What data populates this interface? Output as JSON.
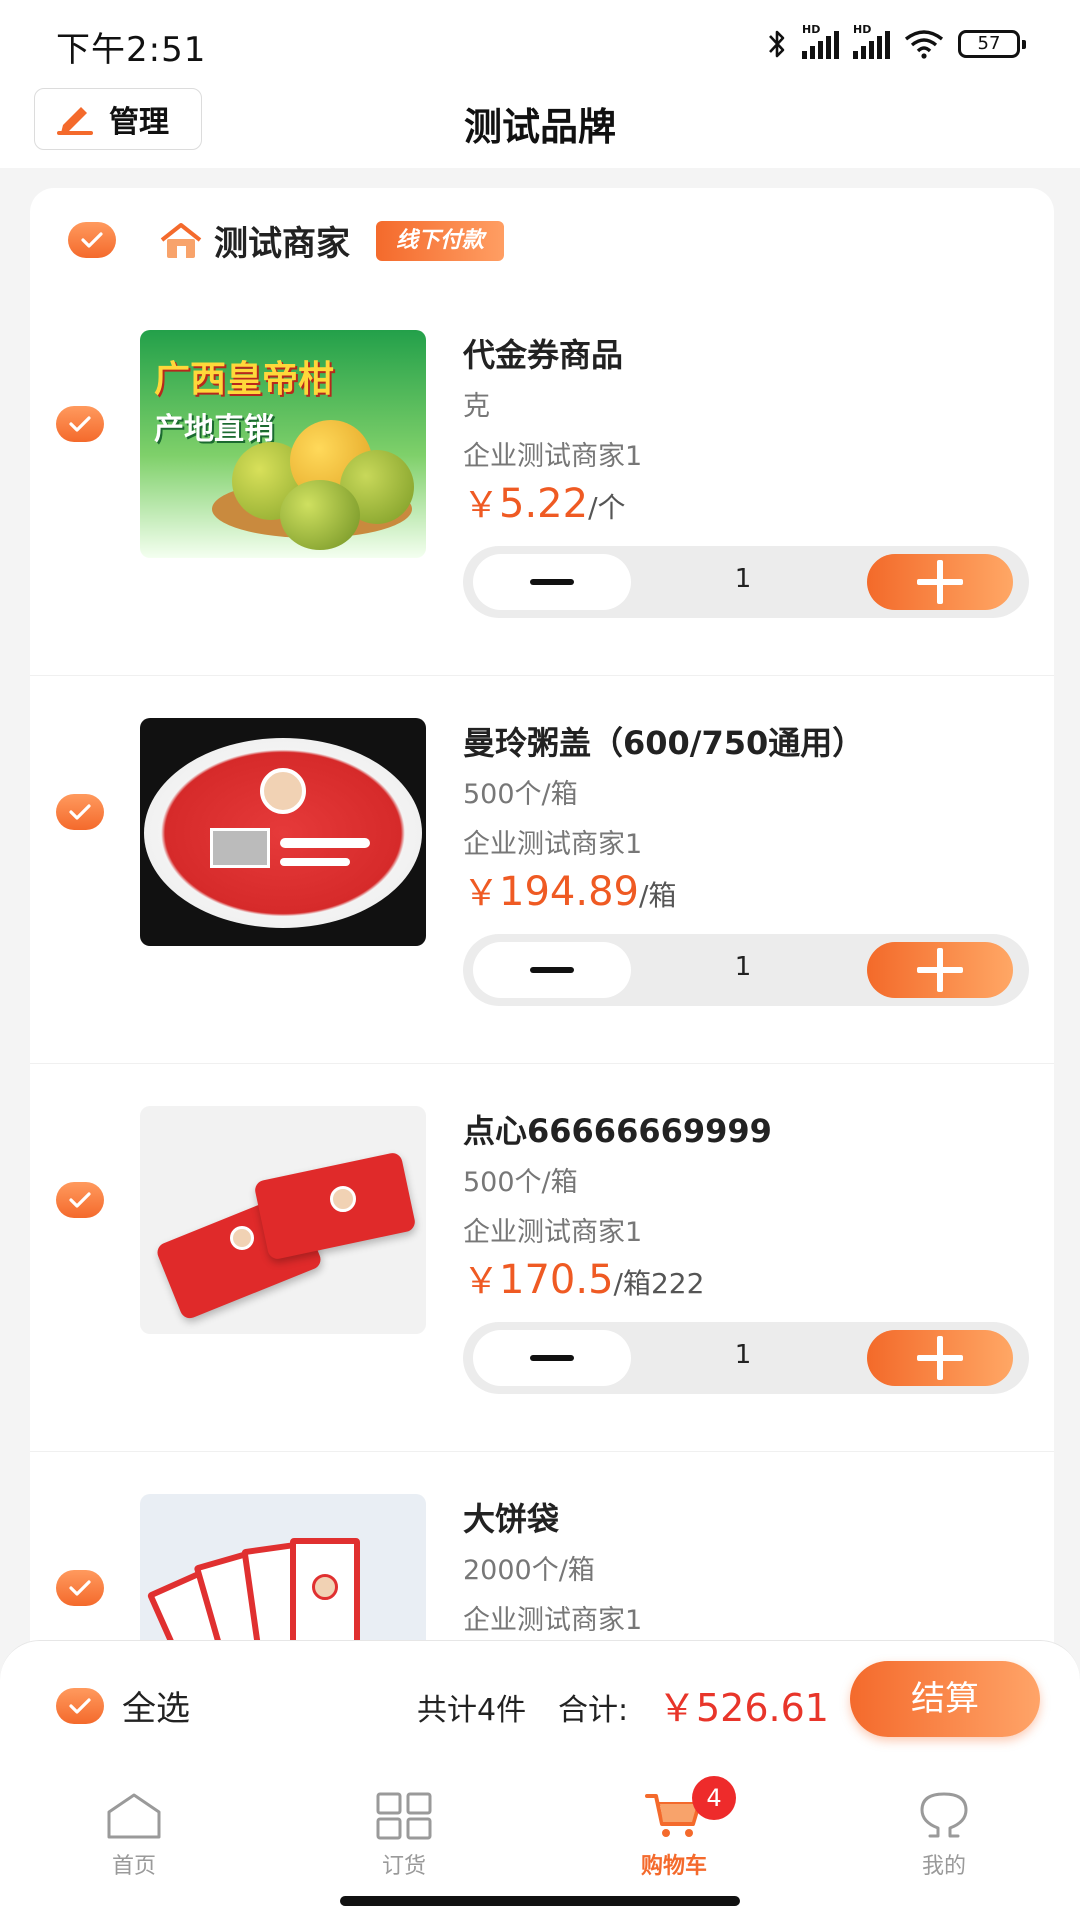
{
  "status_bar": {
    "time": "下午2:51",
    "battery": "57",
    "signal_label": "HD"
  },
  "header": {
    "manage_label": "管理",
    "title": "测试品牌"
  },
  "shop": {
    "name": "测试商家",
    "badge": "线下付款"
  },
  "items": [
    {
      "name": "代金券商品",
      "spec": "克",
      "seller": "企业测试商家1",
      "currency": "￥",
      "price": "5.22",
      "unit": "/个",
      "quantity": "1",
      "image_text": [
        "广西皇帝柑",
        "产地直销"
      ]
    },
    {
      "name": "曼玲粥盖（600/750通用）",
      "spec": "500个/箱",
      "seller": "企业测试商家1",
      "currency": "￥",
      "price": "194.89",
      "unit": "/箱",
      "quantity": "1"
    },
    {
      "name": "点心66666669999",
      "spec": "500个/箱",
      "seller": "企业测试商家1",
      "currency": "￥",
      "price": "170.5",
      "unit": "/箱222",
      "quantity": "1"
    },
    {
      "name": "大饼袋",
      "spec": "2000个/箱",
      "seller": "企业测试商家1"
    }
  ],
  "checkout": {
    "select_all_label": "全选",
    "count_text": "共计4件",
    "total_label": "合计:",
    "total_amount": "￥526.61",
    "checkout_label": "结算"
  },
  "tabs": [
    {
      "label": "首页",
      "icon": "home-icon",
      "active": false
    },
    {
      "label": "订货",
      "icon": "grid-icon",
      "active": false
    },
    {
      "label": "购物车",
      "icon": "cart-icon",
      "active": true,
      "badge": "4"
    },
    {
      "label": "我的",
      "icon": "profile-icon",
      "active": false
    }
  ],
  "colors": {
    "accent": "#f46a2c",
    "price": "#ef5a23",
    "total": "#e8352a",
    "badge": "#ee2b2b"
  }
}
